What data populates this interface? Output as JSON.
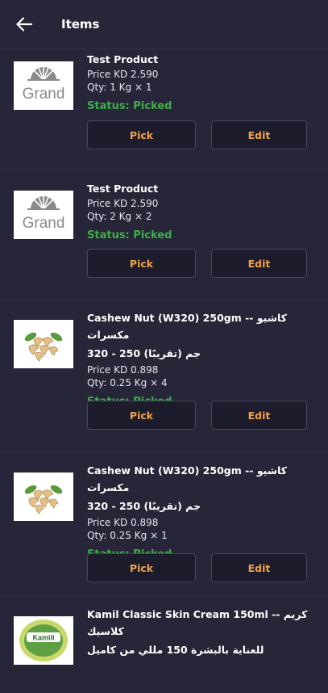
{
  "header": {
    "title": "Items",
    "back_icon": "arrow-left-icon"
  },
  "items": [
    {
      "name": "Test Product",
      "price": "Price KD 2.590",
      "qty": "Qty: 1 Kg × 1",
      "status": "Status: Picked",
      "pick": "Pick",
      "edit": "Edit",
      "logo": "Grand"
    },
    {
      "name": "Test Product",
      "price": "Price KD 2.590",
      "qty": "Qty: 2 Kg × 2",
      "status": "Status: Picked",
      "pick": "Pick",
      "edit": "Edit",
      "logo": "Grand"
    },
    {
      "name_line1": "Cashew Nut (W320) 250gm -- كاشيو مكسرات",
      "name_line2": "320 - 250 جم (تقريبًا)",
      "price": "Price KD 0.898",
      "qty": "Qty: 0.25 Kg × 4",
      "status": "Status: Picked",
      "pick": "Pick",
      "edit": "Edit"
    },
    {
      "name_line1": "Cashew Nut (W320) 250gm -- كاشيو مكسرات",
      "name_line2": "320 - 250 جم (تقريبًا)",
      "price": "Price KD 0.898",
      "qty": "Qty: 0.25 Kg × 1",
      "status": "Status: Picked",
      "pick": "Pick",
      "edit": "Edit"
    },
    {
      "name_line1": "Kamil Classic Skin Cream 150ml -- كريم كلاسيك",
      "name_line2": "للعناية بالبشرة 150 مللي من كاميل",
      "logo": "Kamill"
    }
  ],
  "colors": {
    "background": "#262638",
    "status_green": "#3fae49",
    "button_text": "#f0a24a"
  }
}
